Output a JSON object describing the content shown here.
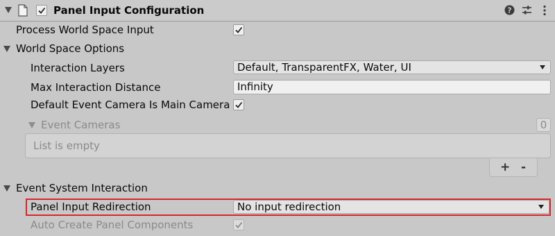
{
  "header": {
    "title": "Panel Input Configuration",
    "icons": [
      "foldout-arrow",
      "script-icon",
      "enabled-checkbox",
      "help-icon",
      "presets-icon",
      "more-menu-icon"
    ]
  },
  "fields": {
    "process_world_space_input": {
      "label": "Process World Space Input",
      "checked": true
    },
    "world_space_options": {
      "label": "World Space Options",
      "expanded": true
    },
    "interaction_layers": {
      "label": "Interaction Layers",
      "value": "Default, TransparentFX, Water, UI"
    },
    "max_interaction_distance": {
      "label": "Max Interaction Distance",
      "value": "Infinity"
    },
    "default_event_camera": {
      "label": "Default Event Camera Is Main Camera",
      "checked": true
    },
    "event_cameras": {
      "label": "Event Cameras",
      "count": "0",
      "empty_text": "List is empty",
      "add": "+",
      "remove": "-"
    },
    "event_system_interaction": {
      "label": "Event System Interaction",
      "expanded": true
    },
    "panel_input_redirection": {
      "label": "Panel Input Redirection",
      "value": "No input redirection",
      "highlighted": true
    },
    "auto_create_panel_components": {
      "label": "Auto Create Panel Components",
      "checked": true,
      "disabled": true
    }
  },
  "colors": {
    "background": "#c8c8c8",
    "highlight": "#d8262c",
    "disabled_text": "#8a8a8a"
  }
}
